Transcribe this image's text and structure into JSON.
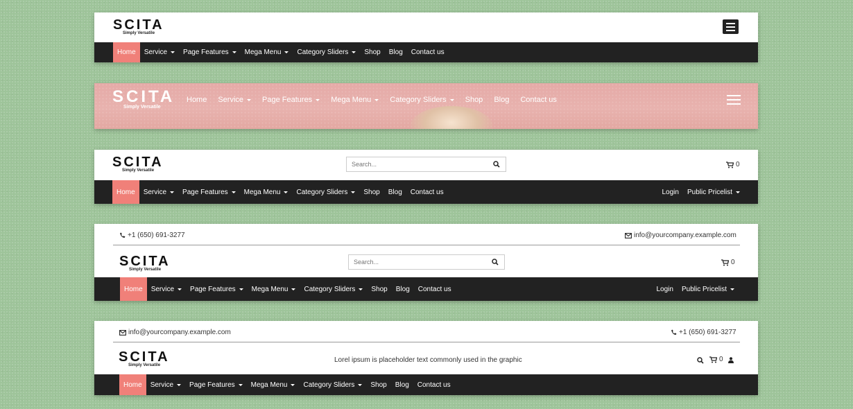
{
  "brand": {
    "name": "SCITA",
    "tagline": "Simply Versatile"
  },
  "nav": {
    "items": [
      "Home",
      "Service",
      "Page Features",
      "Mega Menu",
      "Category Sliders",
      "Shop",
      "Blog",
      "Contact us"
    ],
    "dropdown": [
      false,
      true,
      true,
      true,
      true,
      false,
      false,
      false
    ],
    "right": [
      "Login",
      "Public Pricelist"
    ]
  },
  "search": {
    "placeholder": "Search..."
  },
  "cart": {
    "count": "0"
  },
  "contact": {
    "phone": "+1 (650) 691-3277",
    "email": "info@yourcompany.example.com"
  },
  "promo": {
    "text": "Lorel ipsum is placeholder text commonly used in the graphic"
  },
  "colors": {
    "accent": "#f08079",
    "navbar": "#222222",
    "background": "#9ec49a"
  },
  "icons": [
    "hamburger-icon",
    "search-icon",
    "cart-icon",
    "phone-icon",
    "envelope-icon",
    "user-icon",
    "caret-down-icon"
  ]
}
